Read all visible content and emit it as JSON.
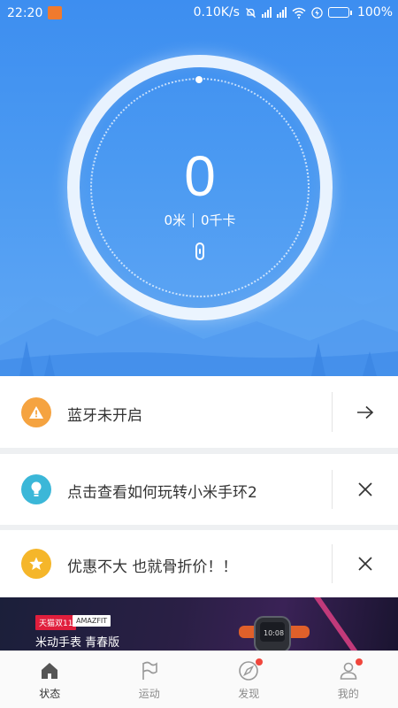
{
  "status_bar": {
    "time": "22:20",
    "network_speed": "0.10K/s",
    "battery_level": "100%",
    "battery_fraction": 1.0
  },
  "dashboard": {
    "steps": "0",
    "distance": "0米",
    "calories": "0千卡"
  },
  "cards": [
    {
      "text": "蓝牙未开启",
      "icon": "warning-icon",
      "icon_color": "#f5a340",
      "action": "arrow-right-icon"
    },
    {
      "text": "点击查看如何玩转小米手环2",
      "icon": "lightbulb-icon",
      "icon_color": "#3bb7d8",
      "action": "close-icon"
    },
    {
      "text": "优惠不大 也就骨折价！！",
      "icon": "star-icon",
      "icon_color": "#f5b62a",
      "action": "close-icon"
    }
  ],
  "ad": {
    "tag_store": "天猫双11",
    "tag_brand": "AMAZFIT",
    "title": "米动手表 青春版"
  },
  "nav": [
    {
      "label": "状态",
      "icon": "home-icon",
      "active": true,
      "badge": false
    },
    {
      "label": "运动",
      "icon": "flag-icon",
      "active": false,
      "badge": false
    },
    {
      "label": "发现",
      "icon": "compass-icon",
      "active": false,
      "badge": true
    },
    {
      "label": "我的",
      "icon": "profile-icon",
      "active": false,
      "badge": true
    }
  ],
  "colors": {
    "hero_top": "#3d8ef0",
    "hero_bottom": "#62a8f4",
    "badge_red": "#f0463c"
  }
}
